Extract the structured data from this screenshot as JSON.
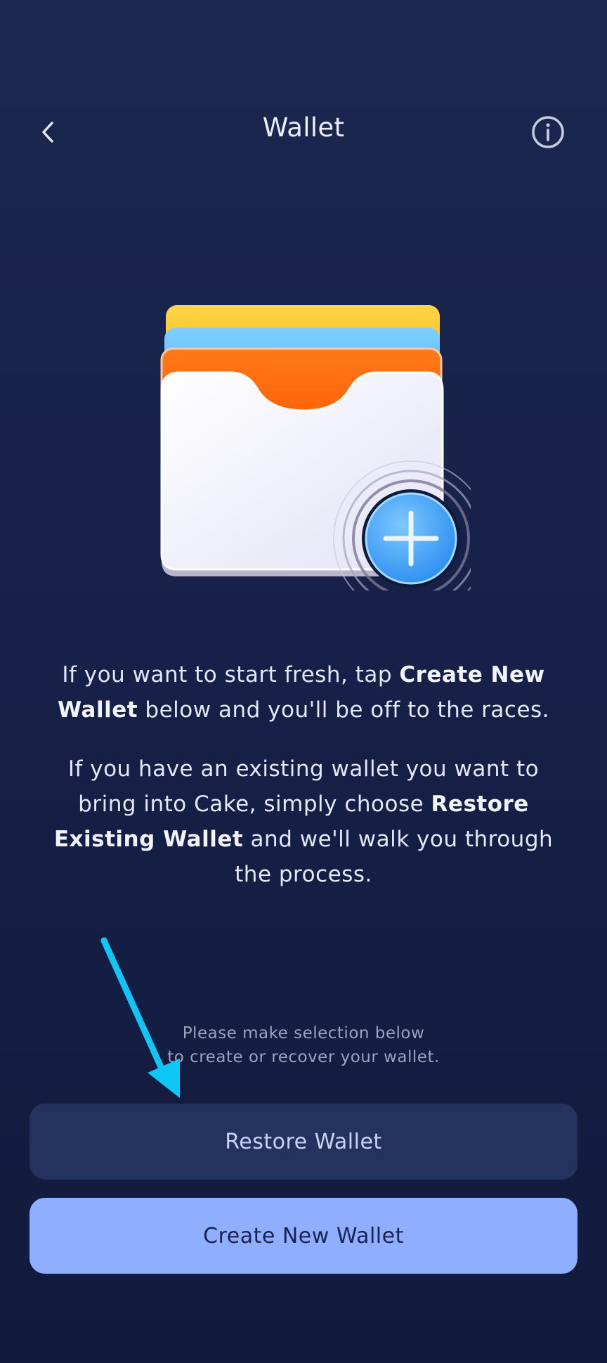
{
  "header": {
    "title": "Wallet",
    "back_icon": "chevron-left-icon",
    "info_icon": "info-icon"
  },
  "illustration": {
    "icon": "wallet-add-illustration",
    "colors": {
      "card_yellow": "#ffc21e",
      "card_blue": "#5ab8f8",
      "card_orange": "#ff6a10",
      "plus_badge": "#4aa8f6"
    }
  },
  "body": {
    "p1_pre": "If you want to start fresh, tap ",
    "p1_bold": "Create New Wallet",
    "p1_post": " below and you'll be off to the races.",
    "p2_pre": "If you have an existing wallet you want to bring into Cake, simply choose ",
    "p2_bold": "Restore Existing Wallet",
    "p2_post": " and we'll walk you through the process."
  },
  "hint": {
    "line1": "Please make selection below",
    "line2": "to create or recover your wallet."
  },
  "annotation": {
    "arrow_color": "#10c6f4"
  },
  "buttons": {
    "restore_label": "Restore Wallet",
    "create_label": "Create New Wallet"
  },
  "colors": {
    "background": "#17214a",
    "restore_button": "#24325e",
    "create_button": "#90aeff"
  }
}
